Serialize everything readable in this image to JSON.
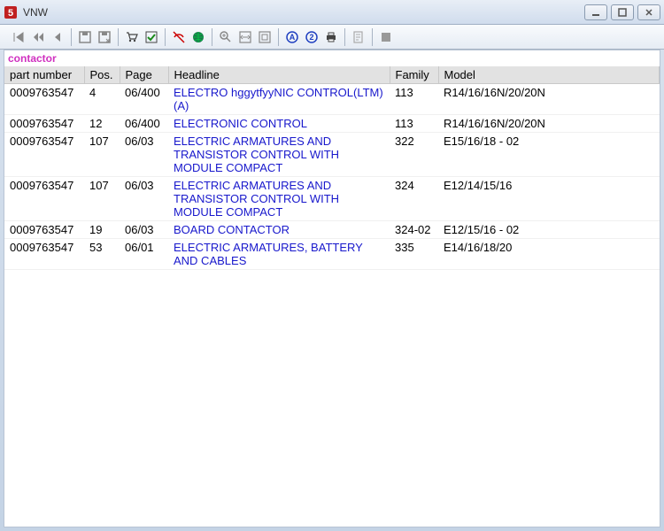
{
  "window": {
    "title": "VNW"
  },
  "search_term": "contactor",
  "columns": {
    "part_number": "part number",
    "pos": "Pos.",
    "page": "Page",
    "headline": "Headline",
    "family": "Family",
    "model": "Model"
  },
  "rows": [
    {
      "part_number": "0009763547",
      "pos": "4",
      "page": "06/400",
      "headline": "ELECTRO    hggytfyyNIC CONTROL(LTM)(A)",
      "family": "113",
      "model": "R14/16/16N/20/20N"
    },
    {
      "part_number": "0009763547",
      "pos": "12",
      "page": "06/400",
      "headline": "ELECTRONIC CONTROL",
      "family": "113",
      "model": "R14/16/16N/20/20N"
    },
    {
      "part_number": "0009763547",
      "pos": "107",
      "page": "06/03",
      "headline": "ELECTRIC ARMATURES AND TRANSISTOR CONTROL WITH MODULE COMPACT",
      "family": "322",
      "model": "E15/16/18 - 02"
    },
    {
      "part_number": "0009763547",
      "pos": "107",
      "page": "06/03",
      "headline": "ELECTRIC ARMATURES AND TRANSISTOR CONTROL WITH MODULE COMPACT",
      "family": "324",
      "model": "E12/14/15/16"
    },
    {
      "part_number": "0009763547",
      "pos": "19",
      "page": "06/03",
      "headline": "BOARD CONTACTOR",
      "family": "324-02",
      "model": "E12/15/16 - 02"
    },
    {
      "part_number": "0009763547",
      "pos": "53",
      "page": "06/01",
      "headline": "ELECTRIC ARMATURES, BATTERY AND CABLES",
      "family": "335",
      "model": "E14/16/18/20"
    }
  ]
}
